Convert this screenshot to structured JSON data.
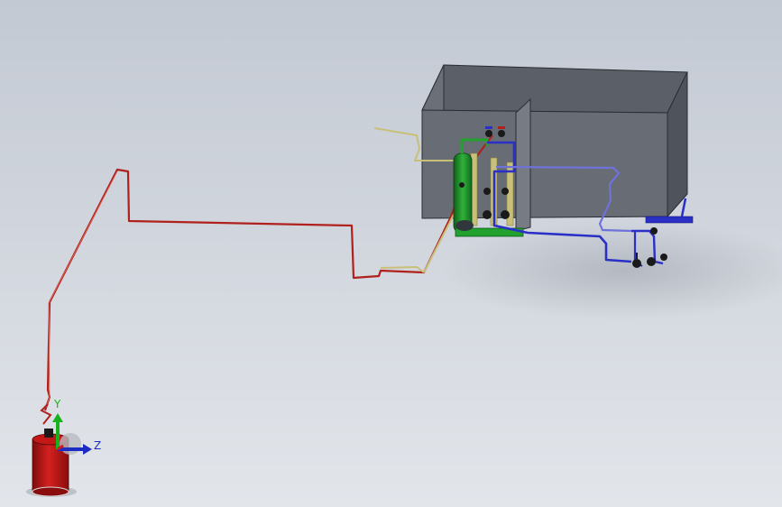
{
  "viewport": {
    "background_top": "#c3c9d3",
    "background_bottom": "#e2e5ea"
  },
  "model": {
    "pipe_colors": {
      "main_supply": "#b0201c",
      "return_line": "#2a2fc6",
      "auxiliary": "#c8c07a",
      "frame": "#22a12e"
    },
    "tank_color": "#5e636c",
    "cylinder_color": "#c01818",
    "pump_tank_color": "#1f8a2a"
  },
  "triad": {
    "x_label": "",
    "y_label": "Y",
    "z_label": "Z",
    "colors": {
      "x": "#d21a1a",
      "y": "#19b21f",
      "z": "#1c2bc2"
    }
  }
}
